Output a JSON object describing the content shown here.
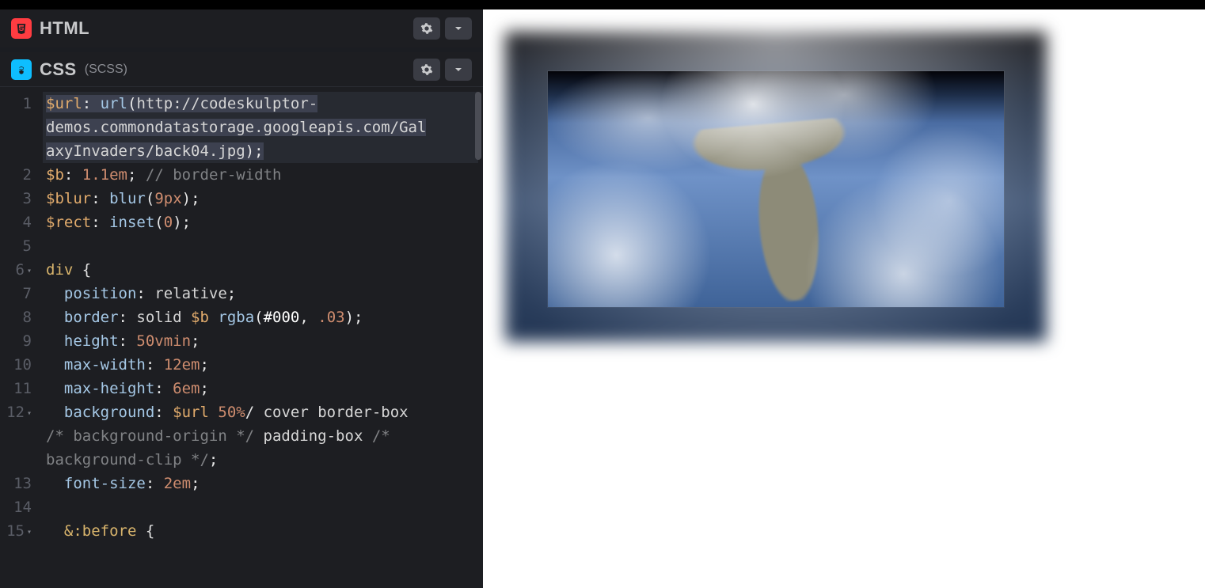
{
  "panels": {
    "html": {
      "title": "HTML",
      "sub": ""
    },
    "css": {
      "title": "CSS",
      "sub": "(SCSS)"
    }
  },
  "css_editor": {
    "gutter": [
      "1",
      "2",
      "3",
      "4",
      "5",
      "6",
      "7",
      "8",
      "9",
      "10",
      "11",
      "12",
      "",
      "13",
      "14",
      "15"
    ],
    "folds": {
      "6": true,
      "12": true,
      "15": true
    },
    "lines": [
      {
        "hl": true,
        "segs": [
          {
            "t": "$url",
            "c": "tk-var"
          },
          {
            "t": ": ",
            "c": "tk-punc"
          },
          {
            "t": "url",
            "c": "tk-kw"
          },
          {
            "t": "(",
            "c": "tk-punc"
          },
          {
            "t": "http://codeskulptor-",
            "c": "tk-val"
          }
        ]
      },
      {
        "hl": true,
        "segs": [
          {
            "t": "demos.commondatastorage.googleapis.com/Gal",
            "c": "tk-val"
          }
        ]
      },
      {
        "hl": true,
        "segs": [
          {
            "t": "axyInvaders/back04.jpg",
            "c": "tk-val"
          },
          {
            "t": ")",
            "c": "tk-punc"
          },
          {
            "t": ";",
            "c": "tk-punc"
          }
        ]
      },
      {
        "segs": [
          {
            "t": "$b",
            "c": "tk-var"
          },
          {
            "t": ": ",
            "c": "tk-punc"
          },
          {
            "t": "1.1em",
            "c": "tk-num"
          },
          {
            "t": "; ",
            "c": "tk-punc"
          },
          {
            "t": "// border-width",
            "c": "tk-cmt"
          }
        ]
      },
      {
        "segs": [
          {
            "t": "$blur",
            "c": "tk-var"
          },
          {
            "t": ": ",
            "c": "tk-punc"
          },
          {
            "t": "blur",
            "c": "tk-kw"
          },
          {
            "t": "(",
            "c": "tk-punc"
          },
          {
            "t": "9px",
            "c": "tk-num"
          },
          {
            "t": ")",
            "c": "tk-punc"
          },
          {
            "t": ";",
            "c": "tk-punc"
          }
        ]
      },
      {
        "segs": [
          {
            "t": "$rect",
            "c": "tk-var"
          },
          {
            "t": ": ",
            "c": "tk-punc"
          },
          {
            "t": "inset",
            "c": "tk-kw"
          },
          {
            "t": "(",
            "c": "tk-punc"
          },
          {
            "t": "0",
            "c": "tk-num"
          },
          {
            "t": ")",
            "c": "tk-punc"
          },
          {
            "t": ";",
            "c": "tk-punc"
          }
        ]
      },
      {
        "segs": [
          {
            "t": " ",
            "c": "tk-punc"
          }
        ]
      },
      {
        "segs": [
          {
            "t": "div",
            "c": "tk-sel"
          },
          {
            "t": " {",
            "c": "tk-brace"
          }
        ]
      },
      {
        "segs": [
          {
            "t": "  position",
            "c": "tk-prop"
          },
          {
            "t": ": ",
            "c": "tk-punc"
          },
          {
            "t": "relative",
            "c": "tk-val"
          },
          {
            "t": ";",
            "c": "tk-punc"
          }
        ]
      },
      {
        "segs": [
          {
            "t": "  border",
            "c": "tk-prop"
          },
          {
            "t": ": ",
            "c": "tk-punc"
          },
          {
            "t": "solid ",
            "c": "tk-val"
          },
          {
            "t": "$b ",
            "c": "tk-var"
          },
          {
            "t": "rgba",
            "c": "tk-kw"
          },
          {
            "t": "(",
            "c": "tk-punc"
          },
          {
            "t": "#000",
            "c": "tk-white"
          },
          {
            "t": ", ",
            "c": "tk-punc"
          },
          {
            "t": ".03",
            "c": "tk-num"
          },
          {
            "t": ")",
            "c": "tk-punc"
          },
          {
            "t": ";",
            "c": "tk-punc"
          }
        ]
      },
      {
        "segs": [
          {
            "t": "  height",
            "c": "tk-prop"
          },
          {
            "t": ": ",
            "c": "tk-punc"
          },
          {
            "t": "50vmin",
            "c": "tk-num"
          },
          {
            "t": ";",
            "c": "tk-punc"
          }
        ]
      },
      {
        "segs": [
          {
            "t": "  max-width",
            "c": "tk-prop"
          },
          {
            "t": ": ",
            "c": "tk-punc"
          },
          {
            "t": "12em",
            "c": "tk-num"
          },
          {
            "t": ";",
            "c": "tk-punc"
          }
        ]
      },
      {
        "segs": [
          {
            "t": "  max-height",
            "c": "tk-prop"
          },
          {
            "t": ": ",
            "c": "tk-punc"
          },
          {
            "t": "6em",
            "c": "tk-num"
          },
          {
            "t": ";",
            "c": "tk-punc"
          }
        ]
      },
      {
        "segs": [
          {
            "t": "  background",
            "c": "tk-prop"
          },
          {
            "t": ": ",
            "c": "tk-punc"
          },
          {
            "t": "$url ",
            "c": "tk-var"
          },
          {
            "t": "50%",
            "c": "tk-num"
          },
          {
            "t": "/ ",
            "c": "tk-punc"
          },
          {
            "t": "cover border-box",
            "c": "tk-val"
          }
        ]
      },
      {
        "segs": [
          {
            "t": "/* background-origin */",
            "c": "tk-cmt"
          },
          {
            "t": " padding-box ",
            "c": "tk-val"
          },
          {
            "t": "/* ",
            "c": "tk-cmt"
          }
        ]
      },
      {
        "segs": [
          {
            "t": "background-clip */",
            "c": "tk-cmt"
          },
          {
            "t": ";",
            "c": "tk-punc"
          }
        ]
      },
      {
        "segs": [
          {
            "t": "  font-size",
            "c": "tk-prop"
          },
          {
            "t": ": ",
            "c": "tk-punc"
          },
          {
            "t": "2em",
            "c": "tk-num"
          },
          {
            "t": ";",
            "c": "tk-punc"
          }
        ]
      },
      {
        "segs": [
          {
            "t": " ",
            "c": "tk-punc"
          }
        ]
      },
      {
        "segs": [
          {
            "t": "  &:before",
            "c": "tk-sel"
          },
          {
            "t": " {",
            "c": "tk-brace"
          }
        ]
      }
    ]
  }
}
